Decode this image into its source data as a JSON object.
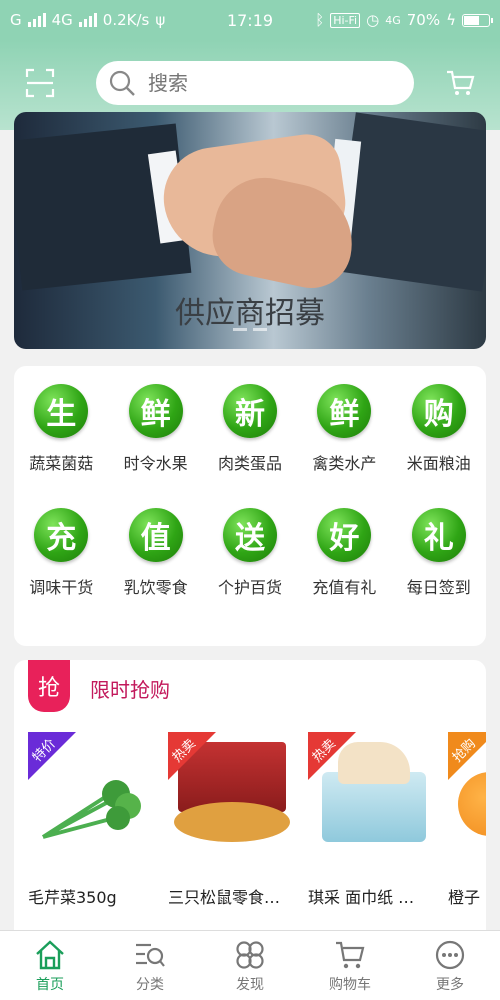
{
  "status": {
    "signal_left": "G",
    "network": "4G",
    "speed": "0.2K/s",
    "time": "17:19",
    "hifi": "Hi-Fi",
    "network_right": "4G",
    "battery_text": "70%",
    "battery_level": 0.7
  },
  "header": {
    "search_placeholder": "搜索"
  },
  "banner": {
    "text": "供应商招募"
  },
  "categories": {
    "items": [
      {
        "icon_char": "生",
        "label": "蔬菜菌菇"
      },
      {
        "icon_char": "鲜",
        "label": "时令水果"
      },
      {
        "icon_char": "新",
        "label": "肉类蛋品"
      },
      {
        "icon_char": "鲜",
        "label": "禽类水产"
      },
      {
        "icon_char": "购",
        "label": "米面粮油"
      },
      {
        "icon_char": "充",
        "label": "调味干货"
      },
      {
        "icon_char": "值",
        "label": "乳饮零食"
      },
      {
        "icon_char": "送",
        "label": "个护百货"
      },
      {
        "icon_char": "好",
        "label": "充值有礼"
      },
      {
        "icon_char": "礼",
        "label": "每日签到"
      }
    ]
  },
  "flash_sale": {
    "badge": "抢",
    "title": "限时抢购",
    "products": [
      {
        "tag": "特价",
        "tag_color": "#6a2bd8",
        "name": "毛芹菜350g",
        "price": ""
      },
      {
        "tag": "热卖",
        "tag_color": "#e53935",
        "name": "三只松鼠零食…",
        "price": ""
      },
      {
        "tag": "热卖",
        "tag_color": "#e53935",
        "name": "琪采  面巾纸 …",
        "price": ""
      },
      {
        "tag": "抢购",
        "tag_color": "#f08a1c",
        "name": "橙子",
        "price": ""
      }
    ]
  },
  "tabbar": {
    "tabs": [
      {
        "label": "首页",
        "icon": "home-icon"
      },
      {
        "label": "分类",
        "icon": "category-search-icon"
      },
      {
        "label": "发现",
        "icon": "discover-icon"
      },
      {
        "label": "购物车",
        "icon": "cart-icon"
      },
      {
        "label": "更多",
        "icon": "more-icon"
      }
    ]
  },
  "colors": {
    "accent": "#1a9e5a",
    "header": "#8fd3b4",
    "sale": "#e8215a"
  }
}
